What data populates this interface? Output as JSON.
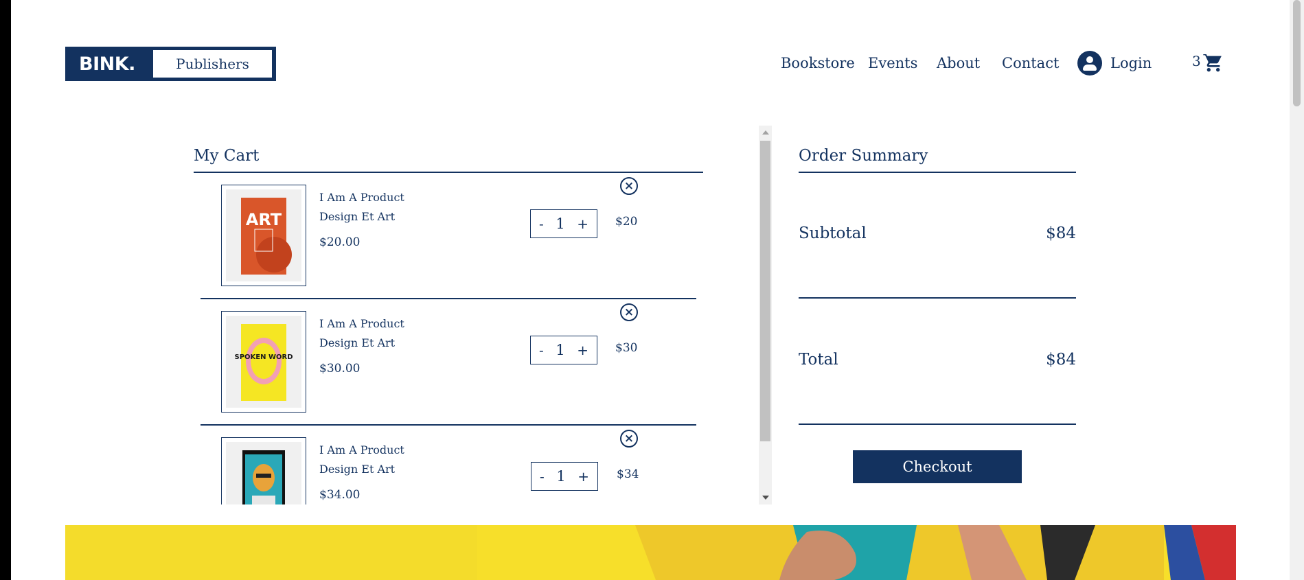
{
  "header": {
    "logo_text": "BINK.",
    "publishers_label": "Publishers",
    "nav": [
      "Bookstore",
      "Events",
      "About",
      "Contact"
    ],
    "login_label": "Login",
    "cart_count": "3"
  },
  "cart": {
    "title": "My Cart",
    "items": [
      {
        "name_line1": "I Am A Product",
        "name_line2": "Design Et Art",
        "price": "$20.00",
        "qty": "1",
        "line_total": "$20",
        "minus": "-",
        "plus": "+",
        "remove": "×",
        "cover_text": "ART"
      },
      {
        "name_line1": "I Am A Product",
        "name_line2": "Design Et Art",
        "price": "$30.00",
        "qty": "1",
        "line_total": "$30",
        "minus": "-",
        "plus": "+",
        "remove": "×",
        "cover_text": "SPOKEN WORD"
      },
      {
        "name_line1": "I Am A Product",
        "name_line2": "Design Et Art",
        "price": "$34.00",
        "qty": "1",
        "line_total": "$34",
        "minus": "-",
        "plus": "+",
        "remove": "×",
        "cover_text": ""
      }
    ]
  },
  "summary": {
    "title": "Order Summary",
    "subtotal_label": "Subtotal",
    "subtotal_value": "$84",
    "total_label": "Total",
    "total_value": "$84",
    "checkout_label": "Checkout"
  },
  "colors": {
    "brand_navy": "#13325f",
    "banner_yellow": "#f7df2a"
  }
}
